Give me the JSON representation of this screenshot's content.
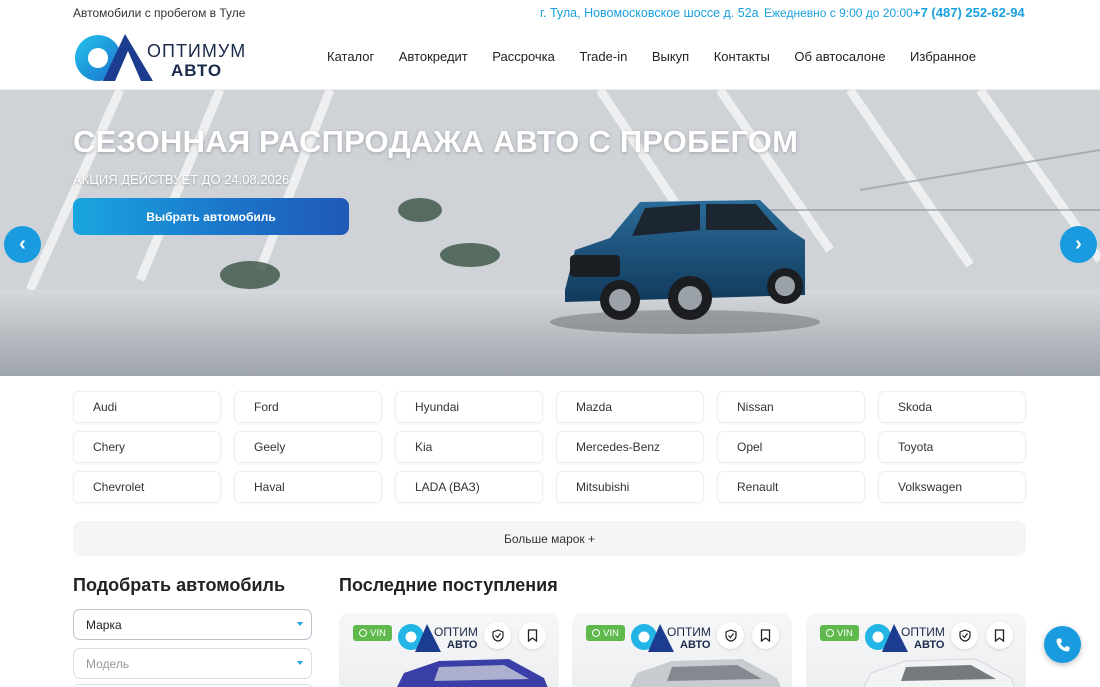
{
  "topbar": {
    "tagline": "Автомобили с пробегом в Туле",
    "address": "г. Тула, Новомосковское шоссе д. 52а",
    "hours": "Ежедневно с 9:00 до 20:00",
    "phone": "+7 (487) 252-62-94"
  },
  "logo": {
    "line1": "ОПТИМУМ",
    "line2": "АВТО"
  },
  "nav": [
    "Каталог",
    "Автокредит",
    "Рассрочка",
    "Trade-in",
    "Выкуп",
    "Контакты",
    "Об автосалоне",
    "Избранное"
  ],
  "hero": {
    "title": "СЕЗОННАЯ РАСПРОДАЖА АВТО С ПРОБЕГОМ",
    "subtitle": "АКЦИЯ ДЕЙСТВУЕТ ДО 24.08.2026",
    "cta": "Выбрать автомобиль",
    "prev": "‹",
    "next": "›"
  },
  "brands": [
    "Audi",
    "Ford",
    "Hyundai",
    "Mazda",
    "Nissan",
    "Skoda",
    "Chery",
    "Geely",
    "Kia",
    "Mercedes-Benz",
    "Opel",
    "Toyota",
    "Chevrolet",
    "Haval",
    "LADA (ВАЗ)",
    "Mitsubishi",
    "Renault",
    "Volkswagen"
  ],
  "more_brands": "Больше марок +",
  "filter": {
    "heading": "Подобрать автомобиль",
    "brand_value": "Марка",
    "model_placeholder": "Модель"
  },
  "latest": {
    "heading": "Последние поступления",
    "cards": [
      {
        "badge": "VIN",
        "logo_text": "ОПТИМ",
        "logo_sub": "АВТО",
        "color": "#3a3fa8"
      },
      {
        "badge": "VIN",
        "logo_text": "ОПТИМ",
        "logo_sub": "АВТО",
        "color": "#c8ccd0"
      },
      {
        "badge": "VIN",
        "logo_text": "ОПТИМ",
        "logo_sub": "АВТО",
        "color": "#e9ebee"
      }
    ]
  },
  "colors": {
    "accent": "#1aa0dc",
    "badge_green": "#5fb94d",
    "logo_dark": "#1b2a4a"
  }
}
